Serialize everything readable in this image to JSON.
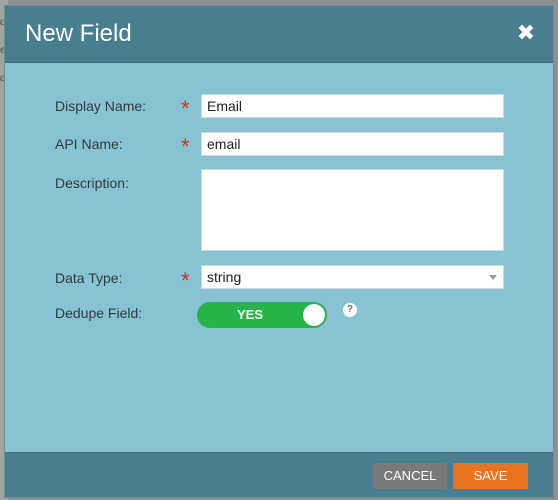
{
  "dialog": {
    "title": "New Field",
    "close_label": "✖"
  },
  "form": {
    "display_name": {
      "label": "Display Name:",
      "required": "*",
      "value": "Email"
    },
    "api_name": {
      "label": "API Name:",
      "required": "*",
      "value": "email"
    },
    "description": {
      "label": "Description:",
      "value": ""
    },
    "data_type": {
      "label": "Data Type:",
      "required": "*",
      "value": "string"
    },
    "dedupe_field": {
      "label": "Dedupe Field:",
      "toggle_label": "YES",
      "state": "on",
      "help": "?"
    }
  },
  "footer": {
    "cancel_label": "CANCEL",
    "save_label": "SAVE"
  },
  "colors": {
    "header": "#497e90",
    "body": "#89c3d3",
    "required": "#c0392b",
    "toggle_on": "#27b24a",
    "save": "#e8741f",
    "cancel": "#7a7a7a"
  }
}
